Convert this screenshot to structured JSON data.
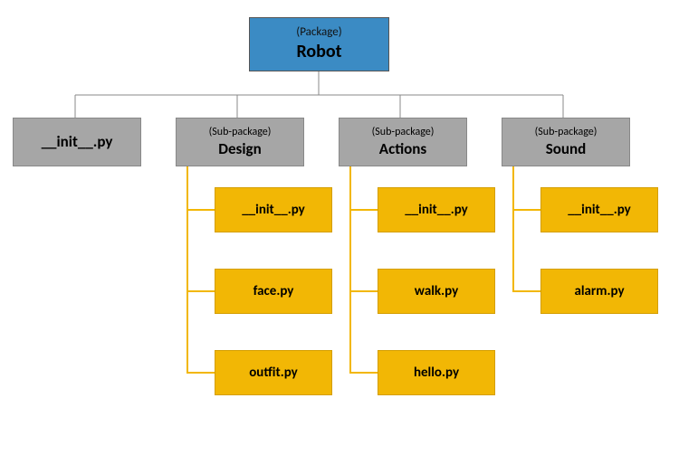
{
  "root": {
    "tag": "(Package)",
    "name": "Robot"
  },
  "level2": {
    "init": {
      "name": "__init__.py"
    },
    "design": {
      "tag": "(Sub-package)",
      "name": "Design"
    },
    "actions": {
      "tag": "(Sub-package)",
      "name": "Actions"
    },
    "sound": {
      "tag": "(Sub-package)",
      "name": "Sound"
    }
  },
  "files": {
    "design": [
      "__init__.py",
      "face.py",
      "outfit.py"
    ],
    "actions": [
      "__init__.py",
      "walk.py",
      "hello.py"
    ],
    "sound": [
      "__init__.py",
      "alarm.py"
    ]
  }
}
